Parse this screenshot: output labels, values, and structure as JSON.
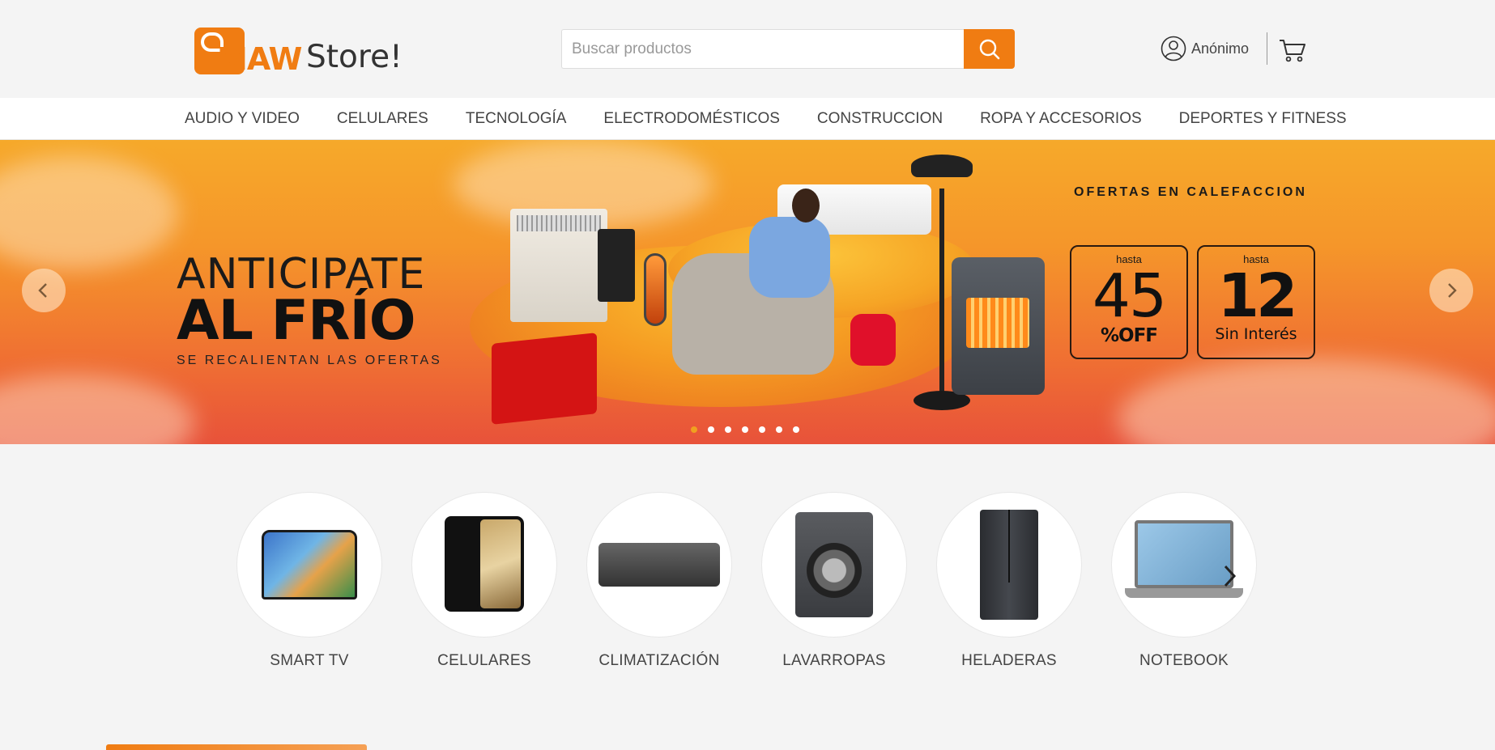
{
  "brand": {
    "logo_primary": "MAW",
    "logo_secondary": "Store!",
    "accent_color": "#f07c12"
  },
  "header": {
    "search": {
      "placeholder": "Buscar productos",
      "icon": "search-icon"
    },
    "user_label": "Anónimo",
    "user_icon": "user-circle-icon",
    "cart_icon": "cart-icon"
  },
  "nav": {
    "items": [
      {
        "label": "AUDIO Y VIDEO"
      },
      {
        "label": "CELULARES"
      },
      {
        "label": "TECNOLOGÍA"
      },
      {
        "label": "ELECTRODOMÉSTICOS"
      },
      {
        "label": "CONSTRUCCION"
      },
      {
        "label": "ROPA Y ACCESORIOS"
      },
      {
        "label": "DEPORTES Y FITNESS"
      }
    ]
  },
  "hero": {
    "headline_line1": "ANTICIPATE",
    "headline_line2": "AL FRÍO",
    "tagline": "SE RECALIENTAN LAS OFERTAS",
    "offer_title": "OFERTAS EN CALEFACCION",
    "offer_a": {
      "small": "hasta",
      "big": "45",
      "sub": "%OFF"
    },
    "offer_b": {
      "small": "hasta",
      "big": "12",
      "sub": "Sin Interés"
    },
    "slide_count": 7,
    "active_slide": 1
  },
  "categories": [
    {
      "label": "SMART TV"
    },
    {
      "label": "CELULARES"
    },
    {
      "label": "CLIMATIZACIÓN"
    },
    {
      "label": "LAVARROPAS"
    },
    {
      "label": "HELADERAS"
    },
    {
      "label": "NOTEBOOK"
    }
  ]
}
